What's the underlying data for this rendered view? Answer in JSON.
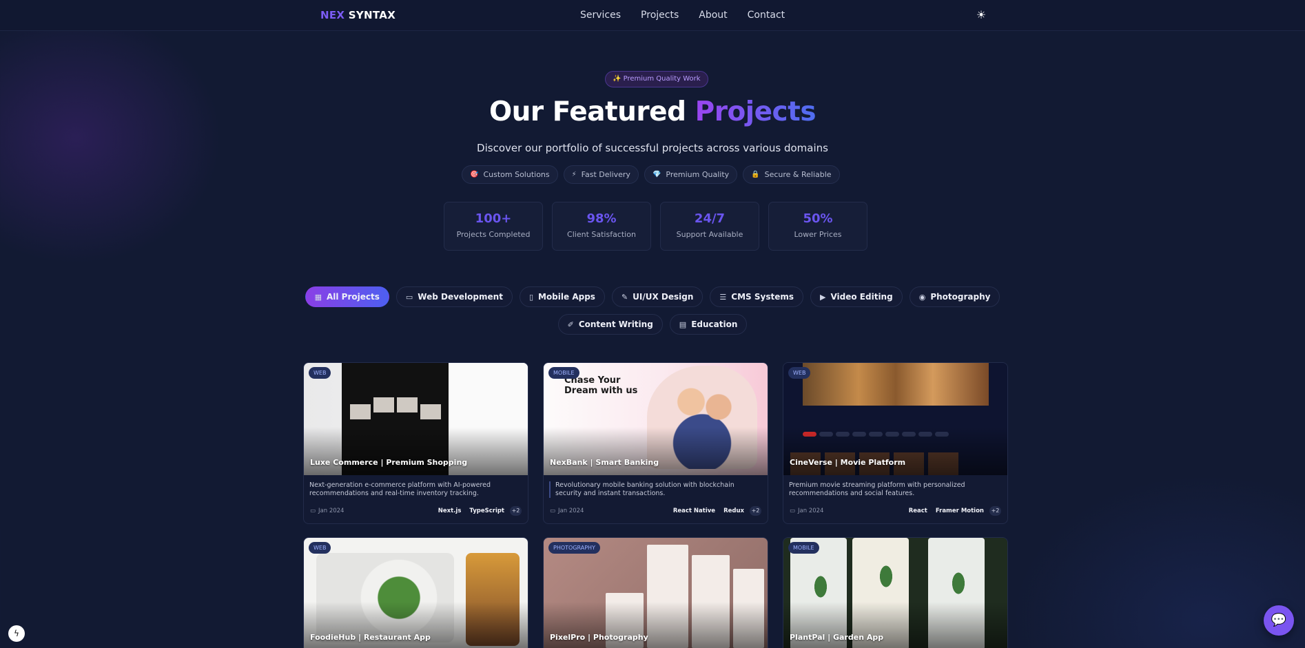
{
  "nav": {
    "logo_a": "NEX",
    "logo_b": "SYNTAX",
    "links": [
      "Services",
      "Projects",
      "About",
      "Contact"
    ],
    "theme_icon": "sun-icon"
  },
  "hero": {
    "badge": "✨ Premium Quality Work",
    "title_a": "Our Featured",
    "title_b": "Projects",
    "subtitle": "Discover our portfolio of successful projects across various domains",
    "features": [
      {
        "icon": "🎯",
        "label": "Custom Solutions"
      },
      {
        "icon": "⚡",
        "label": "Fast Delivery"
      },
      {
        "icon": "💎",
        "label": "Premium Quality"
      },
      {
        "icon": "🔒",
        "label": "Secure & Reliable"
      }
    ],
    "stats": [
      {
        "num": "100+",
        "label": "Projects Completed"
      },
      {
        "num": "98%",
        "label": "Client Satisfaction"
      },
      {
        "num": "24/7",
        "label": "Support Available"
      },
      {
        "num": "50%",
        "label": "Lower Prices"
      }
    ]
  },
  "filters": {
    "row1": [
      {
        "icon": "▦",
        "label": "All Projects",
        "active": true
      },
      {
        "icon": "▭",
        "label": "Web Development"
      },
      {
        "icon": "▯",
        "label": "Mobile Apps"
      },
      {
        "icon": "✎",
        "label": "UI/UX Design"
      },
      {
        "icon": "☰",
        "label": "CMS Systems"
      },
      {
        "icon": "▶",
        "label": "Video Editing"
      },
      {
        "icon": "◉",
        "label": "Photography"
      }
    ],
    "row2": [
      {
        "icon": "✐",
        "label": "Content Writing"
      },
      {
        "icon": "▤",
        "label": "Education"
      }
    ]
  },
  "cards": [
    {
      "tag": "WEB",
      "title": "Luxe Commerce | Premium Shopping",
      "desc": "Next-generation e-commerce platform with AI-powered recommendations and real-time inventory tracking.",
      "date": "Jan 2024",
      "tech": [
        "Next.js",
        "TypeScript"
      ],
      "more": "+2"
    },
    {
      "tag": "MOBILE",
      "title": "NexBank | Smart Banking",
      "desc": "Revolutionary mobile banking solution with blockchain security and instant transactions.",
      "date": "Jan 2024",
      "tech": [
        "React Native",
        "Redux"
      ],
      "more": "+2",
      "thumb_text": "Chase Your\nDream with us"
    },
    {
      "tag": "WEB",
      "title": "CineVerse | Movie Platform",
      "desc": "Premium movie streaming platform with personalized recommendations and social features.",
      "date": "Jan 2024",
      "tech": [
        "React",
        "Framer Motion"
      ],
      "more": "+2"
    },
    {
      "tag": "WEB",
      "title": "FoodieHub | Restaurant App"
    },
    {
      "tag": "PHOTOGRAPHY",
      "title": "PixelPro | Photography"
    },
    {
      "tag": "MOBILE",
      "title": "PlantPal | Garden App"
    }
  ],
  "colors": {
    "accent": "#6a55ef",
    "bg": "#121a33",
    "gradient_start": "#9a45f0",
    "gradient_end": "#4f6ef0"
  }
}
